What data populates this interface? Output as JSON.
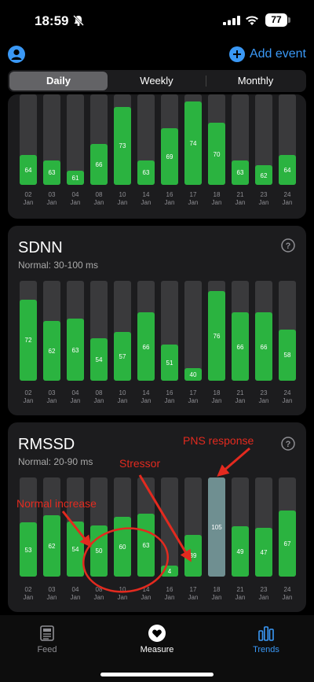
{
  "status": {
    "time": "18:59",
    "battery": "77"
  },
  "header": {
    "add_event_label": "Add event"
  },
  "tabs_period": [
    {
      "label": "Daily",
      "active": true
    },
    {
      "label": "Weekly",
      "active": false
    },
    {
      "label": "Monthly",
      "active": false
    }
  ],
  "cards": [
    {
      "title": "",
      "subtitle": "",
      "chart_data": {
        "type": "bar",
        "categories": [
          "02 Jan",
          "03 Jan",
          "04 Jan",
          "08 Jan",
          "10 Jan",
          "14 Jan",
          "16 Jan",
          "17 Jan",
          "18 Jan",
          "21 Jan",
          "23 Jan",
          "24 Jan"
        ],
        "values": [
          64,
          63,
          61,
          66,
          73,
          63,
          69,
          74,
          70,
          63,
          62,
          64
        ],
        "ylim": [
          60,
          75
        ]
      }
    },
    {
      "title": "SDNN",
      "subtitle": "Normal: 30-100 ms",
      "chart_data": {
        "type": "bar",
        "categories": [
          "02 Jan",
          "03 Jan",
          "04 Jan",
          "08 Jan",
          "10 Jan",
          "14 Jan",
          "16 Jan",
          "17 Jan",
          "18 Jan",
          "21 Jan",
          "23 Jan",
          "24 Jan"
        ],
        "values": [
          72,
          62,
          63,
          54,
          57,
          66,
          51,
          40,
          76,
          66,
          66,
          58
        ],
        "ylim": [
          38,
          76
        ]
      }
    },
    {
      "title": "RMSSD",
      "subtitle": "Normal: 20-90 ms",
      "chart_data": {
        "type": "bar",
        "categories": [
          "02 Jan",
          "03 Jan",
          "04 Jan",
          "08 Jan",
          "10 Jan",
          "14 Jan",
          "16 Jan",
          "17 Jan",
          "18 Jan",
          "21 Jan",
          "23 Jan",
          "24 Jan"
        ],
        "values": [
          53,
          62,
          54,
          50,
          60,
          63,
          4,
          39,
          105,
          49,
          47,
          67
        ],
        "ylim": [
          0,
          105
        ],
        "highlight_index": 8
      }
    }
  ],
  "annotations": {
    "pns": "PNS response",
    "stressor": "Stressor",
    "normal_increase": "Normal increase"
  },
  "colors": {
    "bar": "#2bb340",
    "track": "#3a3a3c",
    "highlight": "#6f8f91",
    "accent": "#3a98f5",
    "annotation": "#e32a1f"
  },
  "bottom_tabs": [
    {
      "label": "Feed",
      "icon": "newspaper-icon"
    },
    {
      "label": "Measure",
      "icon": "heart-icon"
    },
    {
      "label": "Trends",
      "icon": "chart-icon"
    }
  ]
}
